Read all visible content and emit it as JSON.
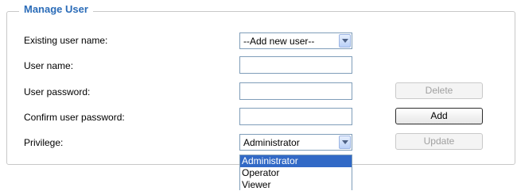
{
  "section": {
    "title": "Manage User"
  },
  "form": {
    "existing_user_label": "Existing user name:",
    "existing_user_value": "--Add new user--",
    "user_name_label": "User name:",
    "user_password_label": "User password:",
    "confirm_password_label": "Confirm user password:",
    "privilege_label": "Privilege:",
    "privilege_value": "Administrator"
  },
  "buttons": {
    "delete": "Delete",
    "add": "Add",
    "update": "Update"
  },
  "privilege_options": [
    "Administrator",
    "Operator",
    "Viewer"
  ]
}
